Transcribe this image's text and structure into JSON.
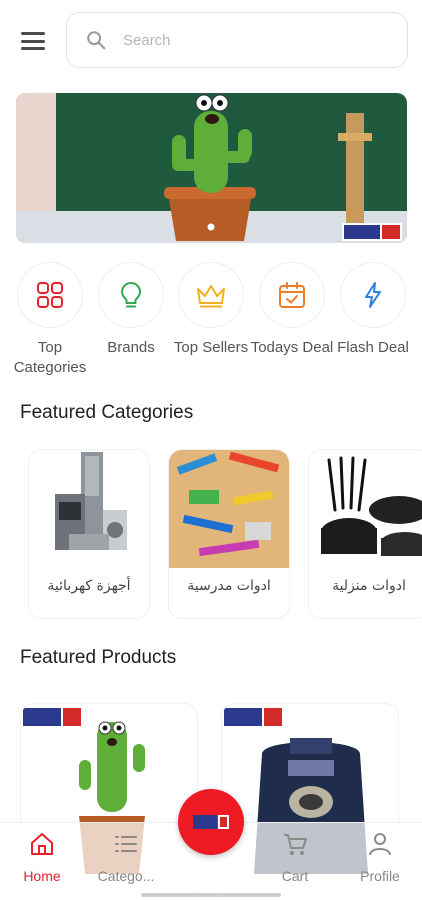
{
  "search": {
    "placeholder": "Search"
  },
  "quick_links": [
    {
      "label": "Top Categories",
      "icon": "categories-grid-icon",
      "color": "#e8212b"
    },
    {
      "label": "Brands",
      "icon": "bulb-icon",
      "color": "#2fa84f"
    },
    {
      "label": "Top Sellers",
      "icon": "crown-icon",
      "color": "#f2b01e"
    },
    {
      "label": "Todays Deal",
      "icon": "calendar-check-icon",
      "color": "#f07b2a"
    },
    {
      "label": "Flash Deal",
      "icon": "lightning-icon",
      "color": "#2d7fe6"
    }
  ],
  "featured_categories": {
    "title": "Featured Categories",
    "items": [
      {
        "label": "أجهزة كهربائية"
      },
      {
        "label": "ادوات مدرسية"
      },
      {
        "label": "ادوات منزلية"
      }
    ]
  },
  "featured_products": {
    "title": "Featured Products"
  },
  "bottom_nav": [
    {
      "label": "Home",
      "icon": "home-icon",
      "active": true
    },
    {
      "label": "Catego...",
      "icon": "list-icon",
      "active": false
    },
    {
      "label": "Cart",
      "icon": "cart-icon",
      "active": false
    },
    {
      "label": "Profile",
      "icon": "profile-icon",
      "active": false
    }
  ],
  "colors": {
    "accent": "#e8212b",
    "fab": "#ee1b24"
  }
}
